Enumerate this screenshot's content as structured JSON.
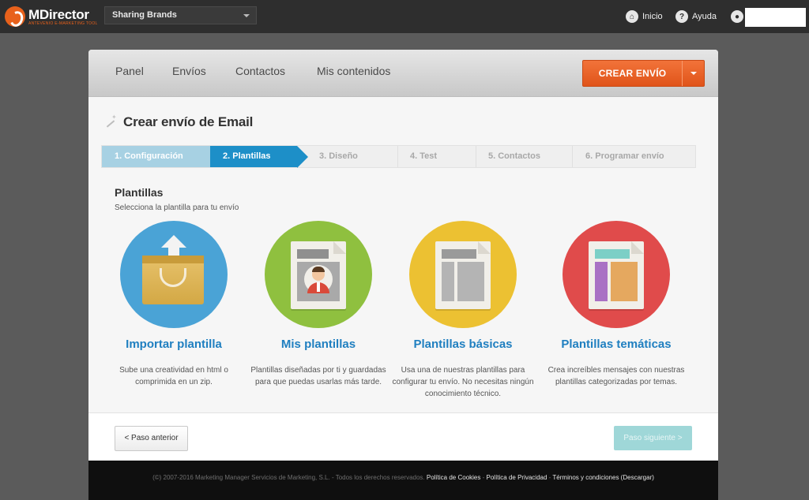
{
  "header": {
    "logo_name": "MDirector",
    "logo_sub": "ANTEVENIO E-MARKETING TOOL",
    "brand_selected": "Sharing Brands",
    "links": [
      {
        "label": "Inicio",
        "icon": "home-icon"
      },
      {
        "label": "Ayuda",
        "icon": "help-icon"
      }
    ],
    "user_icon": "user-icon"
  },
  "nav": {
    "items": [
      "Panel",
      "Envíos",
      "Contactos",
      "Mis contenidos"
    ],
    "create_label": "CREAR ENVÍO"
  },
  "page": {
    "title": "Crear envío de Email"
  },
  "steps": [
    {
      "label": "1. Configuración",
      "state": "done"
    },
    {
      "label": "2. Plantillas",
      "state": "active"
    },
    {
      "label": "3. Diseño",
      "state": "pending"
    },
    {
      "label": "4. Test",
      "state": "pending"
    },
    {
      "label": "5. Contactos",
      "state": "pending"
    },
    {
      "label": "6. Programar envío",
      "state": "pending"
    }
  ],
  "section": {
    "title": "Plantillas",
    "subtitle": "Selecciona la plantilla para tu envío"
  },
  "options": [
    {
      "title": "Importar plantilla",
      "desc": "Sube una creatividad en html o comprimida en un zip.",
      "color": "#4aa3d6",
      "icon": "upload-box-icon"
    },
    {
      "title": "Mis plantillas",
      "desc": "Plantillas diseñadas por ti y guardadas para que puedas usarlas más tarde.",
      "color": "#8fc03f",
      "icon": "user-template-icon"
    },
    {
      "title": "Plantillas básicas",
      "desc": "Usa una de nuestras plantillas para configurar tu envío. No necesitas ningún conocimiento técnico.",
      "color": "#ecc132",
      "icon": "basic-template-icon"
    },
    {
      "title": "Plantillas temáticas",
      "desc": "Crea increíbles mensajes con nuestras plantillas categorizadas por temas.",
      "color": "#e04b4b",
      "icon": "thematic-template-icon"
    }
  ],
  "buttons": {
    "prev": "< Paso anterior",
    "next": "Paso siguiente >"
  },
  "footer": {
    "copyright": "(©) 2007-2016 Marketing Manager Servicios de Marketing, S.L. - Todos los derechos reservados.",
    "link_cookies": "Política de Cookies",
    "link_privacy": "Política de Privacidad",
    "link_terms": "Términos y condiciones (Descargar)"
  }
}
